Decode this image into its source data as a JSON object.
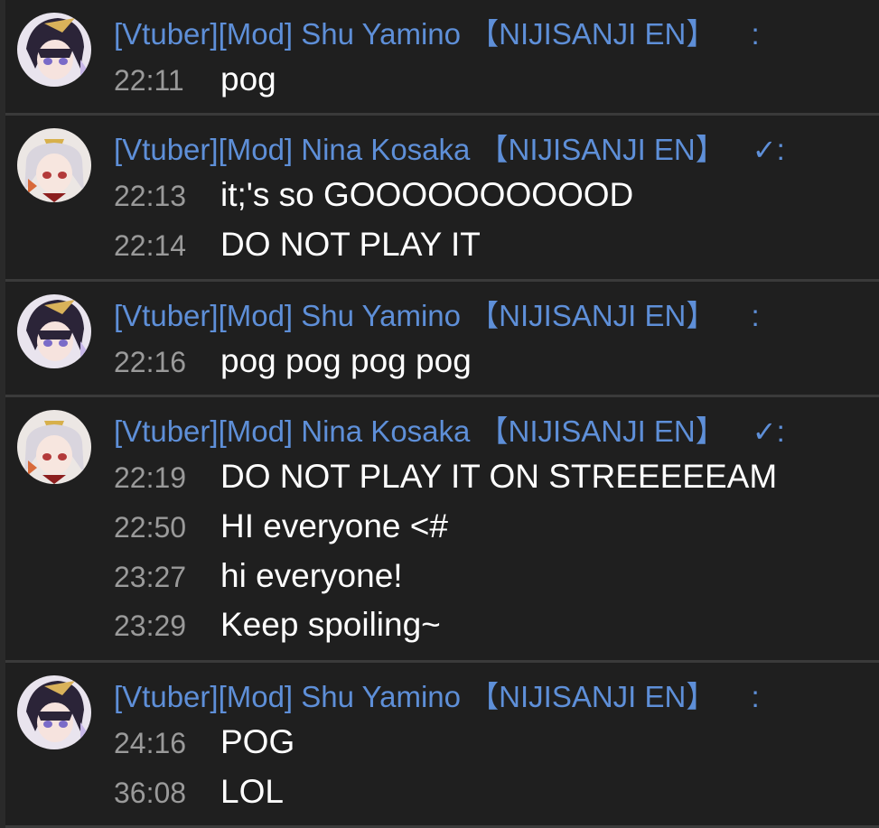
{
  "groups": [
    {
      "avatar": "shu-avatar",
      "author": "[Vtuber][Mod] Shu Yamino 【NIJISANJI EN】",
      "check": "",
      "sep": ":",
      "lines": [
        {
          "time": "22:11",
          "text": "pog"
        }
      ]
    },
    {
      "avatar": "nina-avatar",
      "author": "[Vtuber][Mod] Nina Kosaka 【NIJISANJI EN】",
      "check": "✓",
      "sep": ":",
      "lines": [
        {
          "time": "22:13",
          "text": "it;'s so GOOOOOOOOOOD"
        },
        {
          "time": "22:14",
          "text": "DO NOT PLAY IT"
        }
      ]
    },
    {
      "avatar": "shu-avatar",
      "author": "[Vtuber][Mod] Shu Yamino 【NIJISANJI EN】",
      "check": "",
      "sep": ":",
      "lines": [
        {
          "time": "22:16",
          "text": "pog pog pog pog"
        }
      ]
    },
    {
      "avatar": "nina-avatar",
      "author": "[Vtuber][Mod] Nina Kosaka 【NIJISANJI EN】",
      "check": "✓",
      "sep": ":",
      "lines": [
        {
          "time": "22:19",
          "text": "DO NOT PLAY IT ON STREEEEEAM"
        },
        {
          "time": "22:50",
          "text": "HI everyone <#"
        },
        {
          "time": "23:27",
          "text": "hi everyone!"
        },
        {
          "time": "23:29",
          "text": "Keep spoiling~"
        }
      ]
    },
    {
      "avatar": "shu-avatar",
      "author": "[Vtuber][Mod] Shu Yamino 【NIJISANJI EN】",
      "check": "",
      "sep": ":",
      "lines": [
        {
          "time": "24:16",
          "text": "POG"
        },
        {
          "time": "36:08",
          "text": "LOL"
        }
      ]
    }
  ],
  "colors": {
    "background": "#1f1f1f",
    "author": "#5e8fd8",
    "timestamp": "#9a9a9a",
    "message": "#ffffff",
    "divider": "#3a3a3a"
  }
}
